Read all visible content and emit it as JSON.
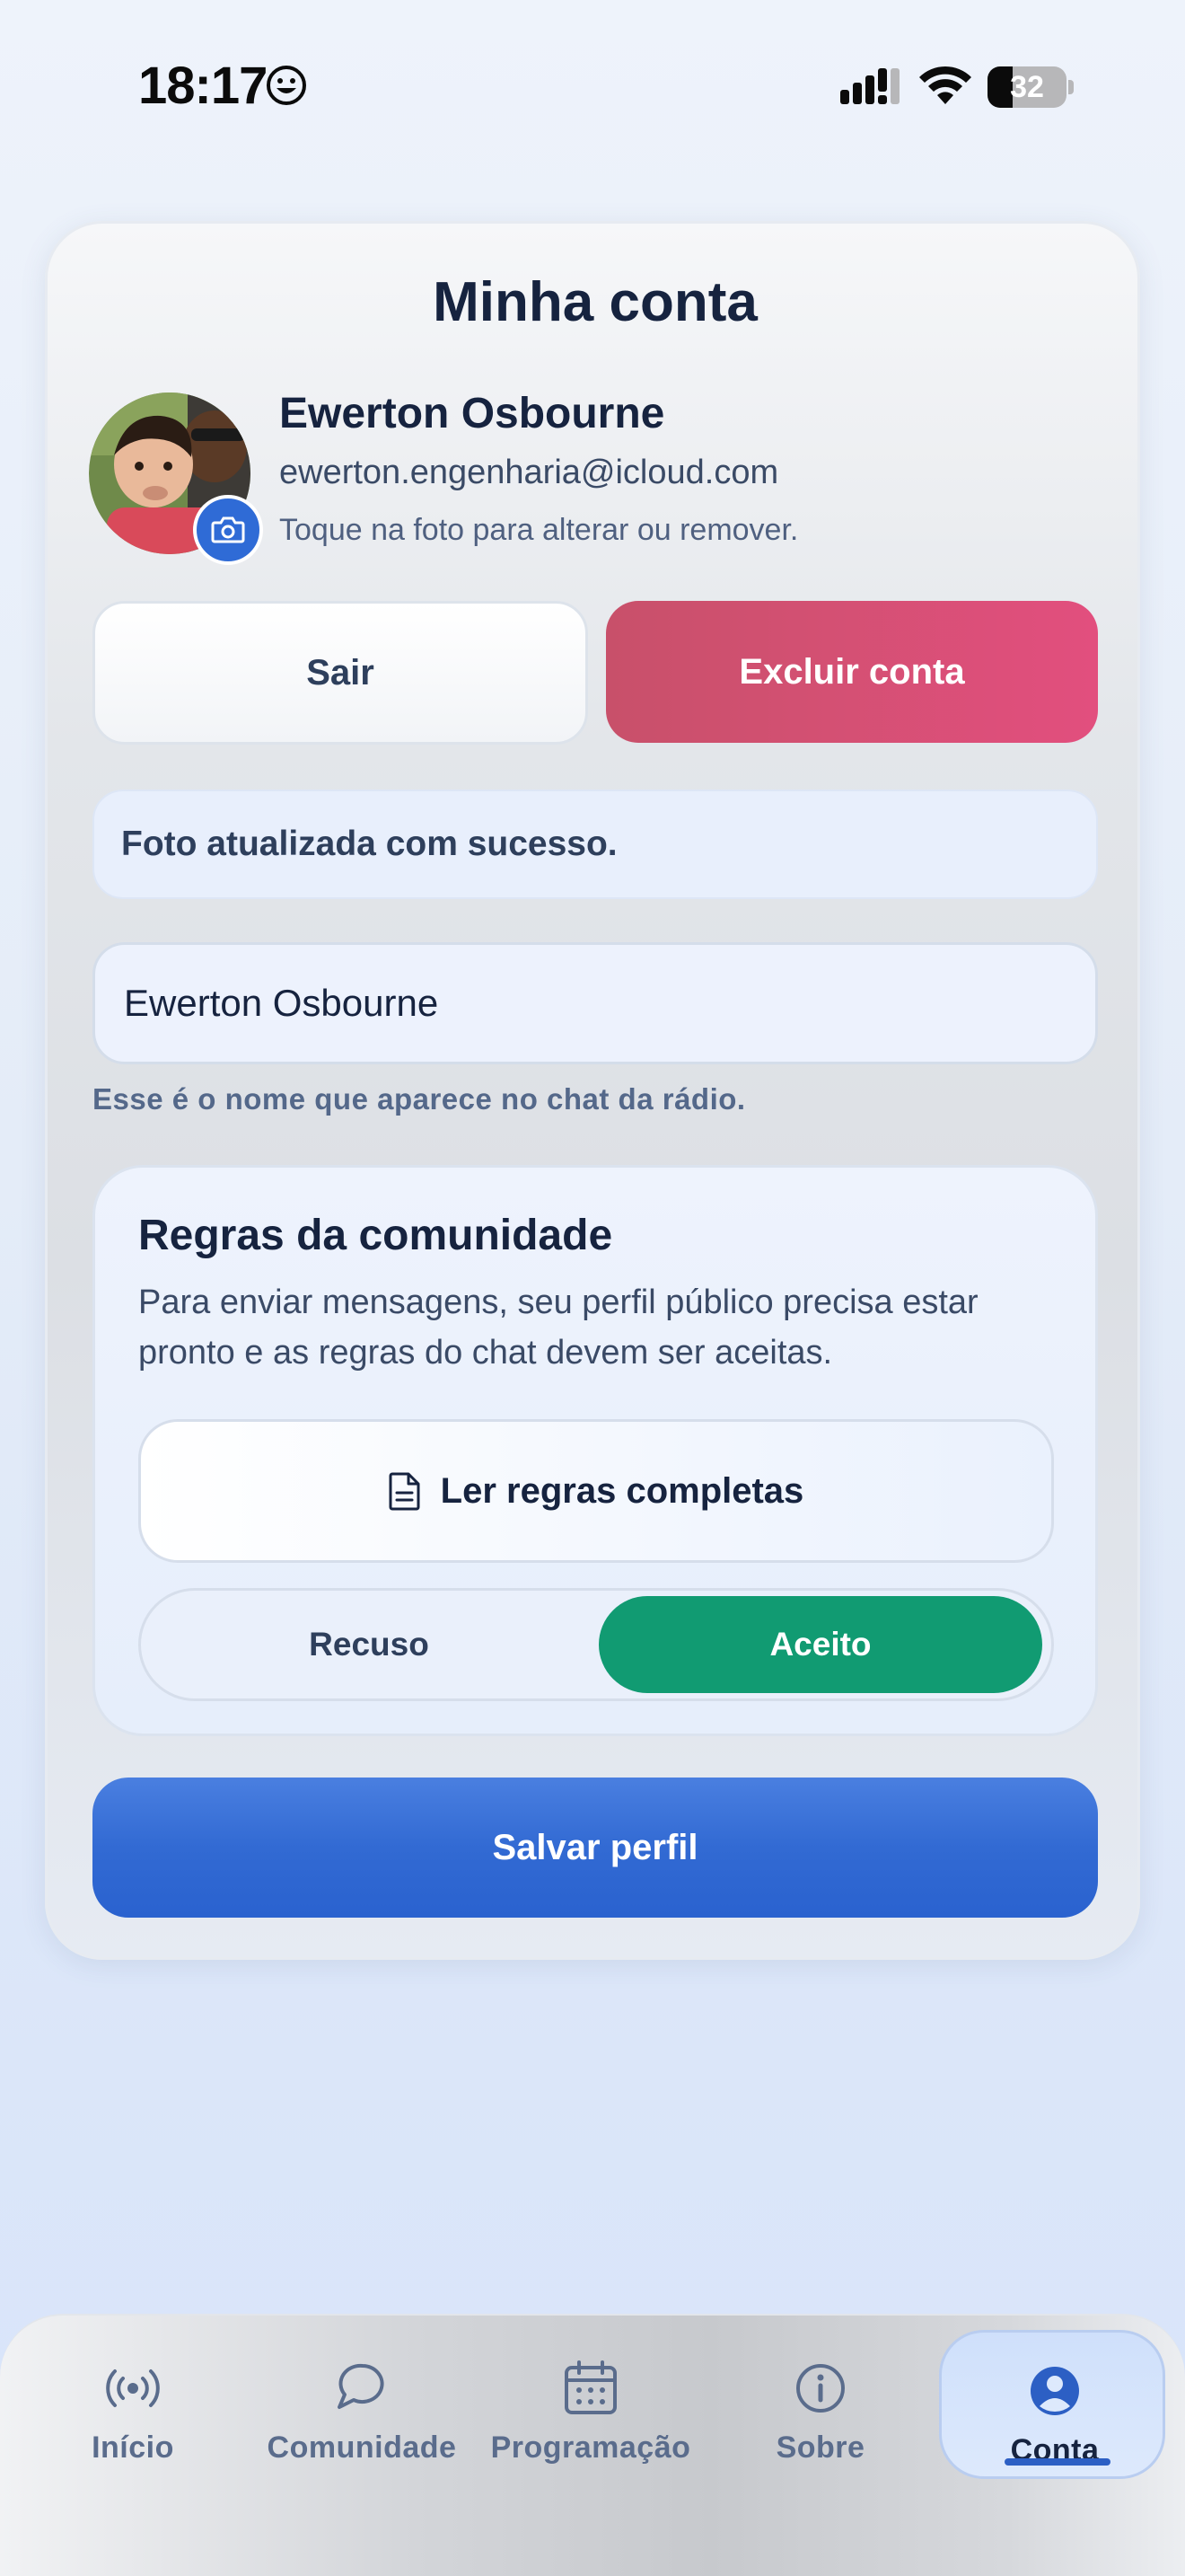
{
  "status_bar": {
    "time": "18:17",
    "battery_level": "32"
  },
  "account": {
    "title": "Minha conta",
    "name": "Ewerton Osbourne",
    "email": "ewerton.engenharia@icloud.com",
    "photo_hint": "Toque na foto para alterar ou remover.",
    "logout_label": "Sair",
    "delete_label": "Excluir conta",
    "success_message": "Foto atualizada com sucesso.",
    "name_field_value": "Ewerton Osbourne",
    "name_helper": "Esse é o nome que aparece no chat da rádio.",
    "save_label": "Salvar perfil"
  },
  "rules": {
    "title": "Regras da comunidade",
    "description": "Para enviar mensagens, seu perfil público precisa estar pronto e as regras do chat devem ser aceitas.",
    "read_label": "Ler regras completas",
    "refuse_label": "Recuso",
    "accept_label": "Aceito",
    "selected": "Aceito"
  },
  "tabs": [
    {
      "label": "Início",
      "icon": "radio-broadcast-icon"
    },
    {
      "label": "Comunidade",
      "icon": "chat-bubble-icon"
    },
    {
      "label": "Programação",
      "icon": "calendar-icon"
    },
    {
      "label": "Sobre",
      "icon": "info-icon"
    },
    {
      "label": "Conta",
      "icon": "user-icon",
      "active": true
    }
  ],
  "colors": {
    "accent": "#2f6bd6",
    "danger": "#e24f7e",
    "success": "#119b72",
    "text_primary": "#16233f"
  }
}
